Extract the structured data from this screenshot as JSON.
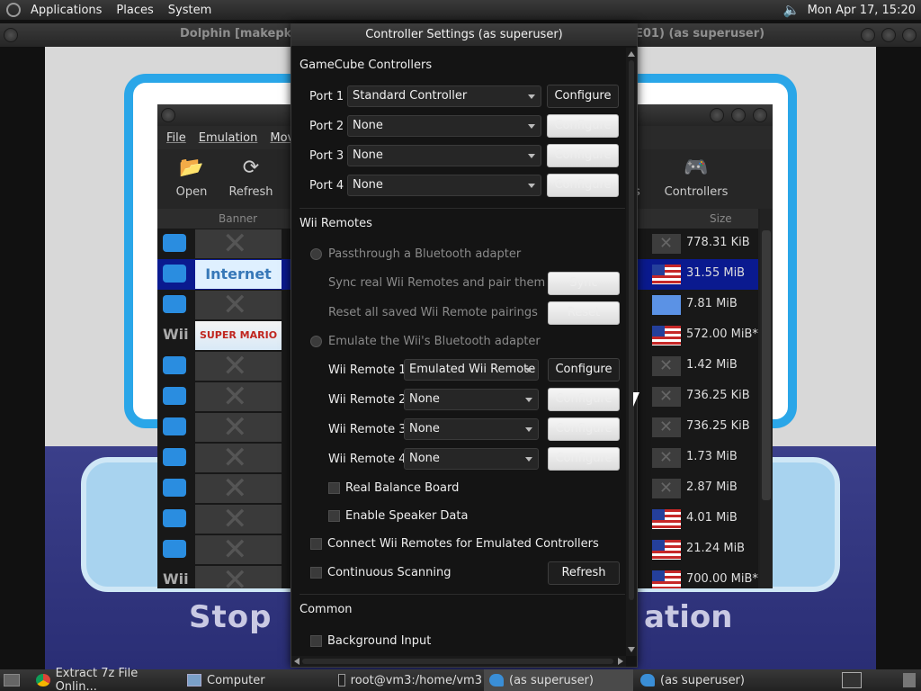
{
  "top_panel": {
    "menus": [
      "Applications",
      "Places",
      "System"
    ],
    "clock": "Mon Apr 17, 15:20"
  },
  "render_window": {
    "title_left": "Dolphin [makepkg]",
    "title_right": "E01) (as superuser)",
    "game_text_left": "Stop",
    "game_text_right": "ation"
  },
  "dolphin": {
    "menu": [
      "File",
      "Emulation",
      "Movie"
    ],
    "toolbar": {
      "open": "Open",
      "refresh": "Refresh",
      "graphics_partial": "ics",
      "controllers": "Controllers"
    },
    "columns": {
      "banner": "Banner",
      "size": "Size"
    },
    "rows": [
      {
        "platform": "wiiware",
        "banner": "x",
        "region": "x",
        "size": "778.31 KiB",
        "selected": false
      },
      {
        "platform": "wiiware",
        "banner": "Internet",
        "region": "us",
        "size": "31.55 MiB",
        "selected": true
      },
      {
        "platform": "wiiware",
        "banner": "x",
        "region": "un",
        "size": "7.81 MiB",
        "selected": false
      },
      {
        "platform": "Wii",
        "banner": "SUPER MARIO BROS. Wii",
        "region": "us",
        "size": "572.00 MiB*",
        "selected": false
      },
      {
        "platform": "wiiware",
        "banner": "x",
        "region": "x",
        "size": "1.42 MiB",
        "selected": false
      },
      {
        "platform": "wiiware",
        "banner": "x",
        "region": "x",
        "size": "736.25 KiB",
        "selected": false
      },
      {
        "platform": "wiiware",
        "banner": "x",
        "region": "x",
        "size": "736.25 KiB",
        "selected": false
      },
      {
        "platform": "wiiware",
        "banner": "x",
        "region": "x",
        "size": "1.73 MiB",
        "selected": false
      },
      {
        "platform": "wiiware",
        "banner": "x",
        "region": "x",
        "size": "2.87 MiB",
        "selected": false
      },
      {
        "platform": "wiiware",
        "banner": "x",
        "region": "us",
        "size": "4.01 MiB",
        "selected": false
      },
      {
        "platform": "wiiware",
        "banner": "x",
        "region": "us",
        "size": "21.24 MiB",
        "selected": false
      },
      {
        "platform": "Wii",
        "banner": "x",
        "region": "us",
        "size": "700.00 MiB*",
        "selected": false
      }
    ]
  },
  "dialog": {
    "title": "Controller Settings (as superuser)",
    "gamecube": {
      "heading": "GameCube Controllers",
      "ports": [
        {
          "label": "Port 1",
          "value": "Standard Controller",
          "button": "Configure",
          "enabled": true
        },
        {
          "label": "Port 2",
          "value": "None",
          "button": "Configure",
          "enabled": false
        },
        {
          "label": "Port 3",
          "value": "None",
          "button": "Configure",
          "enabled": false
        },
        {
          "label": "Port 4",
          "value": "None",
          "button": "Configure",
          "enabled": false
        }
      ]
    },
    "wii": {
      "heading": "Wii Remotes",
      "passthrough_label": "Passthrough a Bluetooth adapter",
      "sync_label": "Sync real Wii Remotes and pair them",
      "sync_button": "Sync",
      "reset_label": "Reset all saved Wii Remote pairings",
      "reset_button": "Reset",
      "emulate_label": "Emulate the Wii's Bluetooth adapter",
      "remotes": [
        {
          "label": "Wii Remote 1",
          "value": "Emulated Wii Remote",
          "button": "Configure",
          "enabled": true
        },
        {
          "label": "Wii Remote 2",
          "value": "None",
          "button": "Configure",
          "enabled": false
        },
        {
          "label": "Wii Remote 3",
          "value": "None",
          "button": "Configure",
          "enabled": false
        },
        {
          "label": "Wii Remote 4",
          "value": "None",
          "button": "Configure",
          "enabled": false
        }
      ],
      "balance_board": "Real Balance Board",
      "speaker_data": "Enable Speaker Data",
      "connect_emulated": "Connect Wii Remotes for Emulated Controllers",
      "continuous_scanning": "Continuous Scanning",
      "refresh_button": "Refresh"
    },
    "common": {
      "heading": "Common",
      "background_input": "Background Input"
    }
  },
  "taskbar": {
    "items": [
      "Extract 7z File Onlin...",
      "Computer",
      "root@vm3:/home/vm3",
      "(as superuser)",
      "(as superuser)"
    ]
  }
}
